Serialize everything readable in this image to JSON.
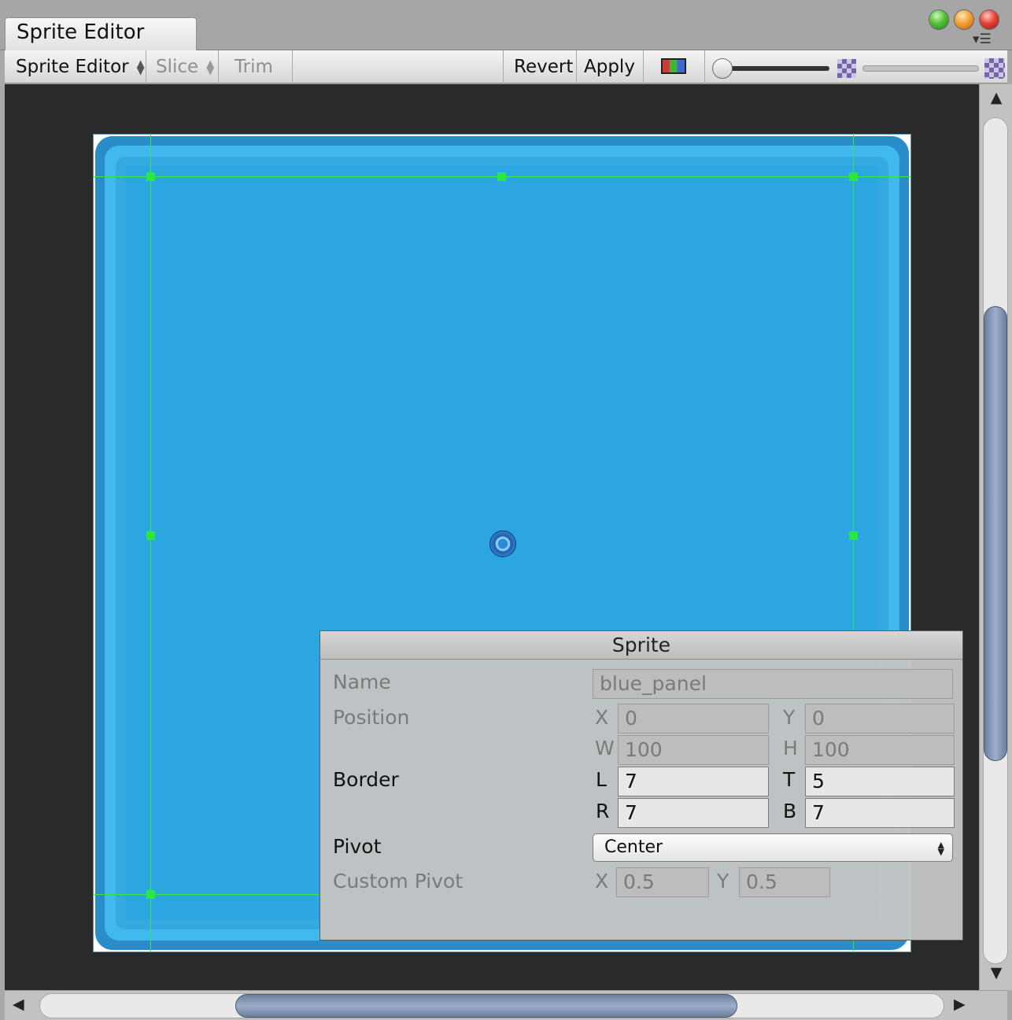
{
  "window": {
    "tab_title": "Sprite Editor",
    "traffic_lights": [
      "green",
      "yellow",
      "red"
    ],
    "menu_icon": "tab-menu-icon"
  },
  "toolbar": {
    "mode_label": "Sprite Editor",
    "slice_label": "Slice",
    "trim_label": "Trim",
    "revert_label": "Revert",
    "apply_label": "Apply",
    "color_channel_icon": "rgb-channels-icon",
    "mip_small_icon": "checker-icon",
    "mip_large_icon": "checker-icon"
  },
  "sprite": {
    "colors": {
      "outer": "#2a8cc8",
      "light": "#42b8f1",
      "fill": "#2ba6e0",
      "guides": "#33e84a",
      "canvas": "#2a2a2a"
    }
  },
  "panel": {
    "title": "Sprite",
    "name": {
      "label": "Name",
      "value": "blue_panel"
    },
    "position": {
      "label": "Position",
      "x_label": "X",
      "x": "0",
      "y_label": "Y",
      "y": "0",
      "w_label": "W",
      "w": "100",
      "h_label": "H",
      "h": "100"
    },
    "border": {
      "label": "Border",
      "l_label": "L",
      "l": "7",
      "t_label": "T",
      "t": "5",
      "r_label": "R",
      "r": "7",
      "b_label": "B",
      "b": "7"
    },
    "pivot": {
      "label": "Pivot",
      "value": "Center"
    },
    "custom_pivot": {
      "label": "Custom Pivot",
      "x_label": "X",
      "x": "0.5",
      "y_label": "Y",
      "y": "0.5"
    }
  }
}
